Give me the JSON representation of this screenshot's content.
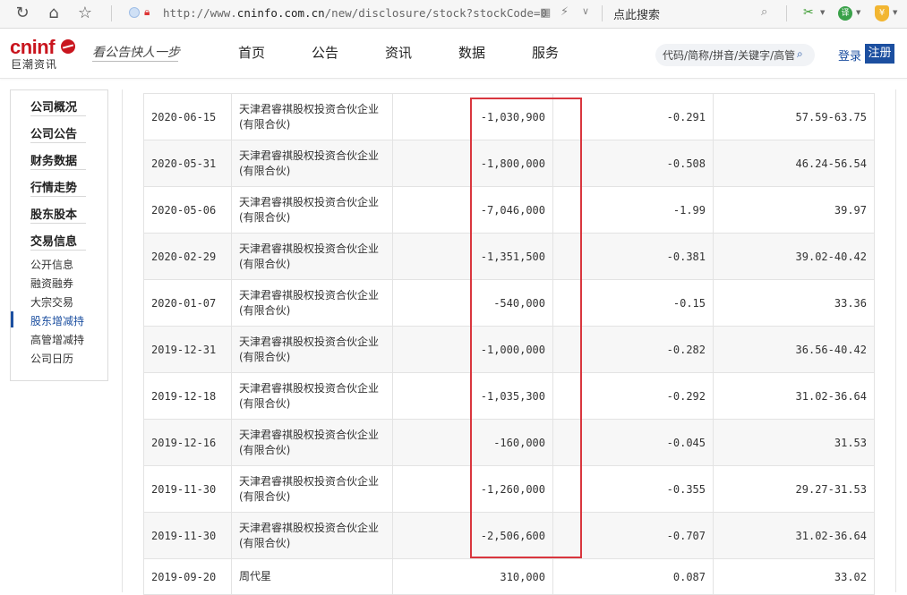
{
  "browser": {
    "url_prefix": "http://www.",
    "url_host": "cninfo.com.cn",
    "url_path": "/new/disclosure/stock?stockCode=0",
    "search_label": "点此搜索"
  },
  "site": {
    "logo_text": "cninf",
    "logo_cn": "巨潮资讯",
    "slogan": "看公告快人一步",
    "nav": [
      "首页",
      "公告",
      "资讯",
      "数据",
      "服务"
    ],
    "search_placeholder": "代码/简称/拼音/关键字/高管",
    "login": "登录",
    "register": "注册",
    "brand_color": "#c9151e",
    "accent_color": "#1c4fa0"
  },
  "sidebar": {
    "main_items": [
      "公司概况",
      "公司公告",
      "财务数据",
      "行情走势",
      "股东股本",
      "交易信息"
    ],
    "sub_items": [
      "公开信息",
      "融资融券",
      "大宗交易",
      "股东增减持",
      "高管增减持",
      "公司日历"
    ],
    "active_sub": "股东增减持"
  },
  "table": {
    "rows": [
      {
        "date": "2020-06-15",
        "holder_l1": "天津君睿祺股权投资合伙企业",
        "holder_l2": "(有限合伙)",
        "change": "-1,030,900",
        "ratio": "-0.291",
        "price": "57.59-63.75"
      },
      {
        "date": "2020-05-31",
        "holder_l1": "天津君睿祺股权投资合伙企业",
        "holder_l2": "(有限合伙)",
        "change": "-1,800,000",
        "ratio": "-0.508",
        "price": "46.24-56.54"
      },
      {
        "date": "2020-05-06",
        "holder_l1": "天津君睿祺股权投资合伙企业",
        "holder_l2": "(有限合伙)",
        "change": "-7,046,000",
        "ratio": "-1.99",
        "price": "39.97"
      },
      {
        "date": "2020-02-29",
        "holder_l1": "天津君睿祺股权投资合伙企业",
        "holder_l2": "(有限合伙)",
        "change": "-1,351,500",
        "ratio": "-0.381",
        "price": "39.02-40.42"
      },
      {
        "date": "2020-01-07",
        "holder_l1": "天津君睿祺股权投资合伙企业",
        "holder_l2": "(有限合伙)",
        "change": "-540,000",
        "ratio": "-0.15",
        "price": "33.36"
      },
      {
        "date": "2019-12-31",
        "holder_l1": "天津君睿祺股权投资合伙企业",
        "holder_l2": "(有限合伙)",
        "change": "-1,000,000",
        "ratio": "-0.282",
        "price": "36.56-40.42"
      },
      {
        "date": "2019-12-18",
        "holder_l1": "天津君睿祺股权投资合伙企业",
        "holder_l2": "(有限合伙)",
        "change": "-1,035,300",
        "ratio": "-0.292",
        "price": "31.02-36.64"
      },
      {
        "date": "2019-12-16",
        "holder_l1": "天津君睿祺股权投资合伙企业",
        "holder_l2": "(有限合伙)",
        "change": "-160,000",
        "ratio": "-0.045",
        "price": "31.53"
      },
      {
        "date": "2019-11-30",
        "holder_l1": "天津君睿祺股权投资合伙企业",
        "holder_l2": "(有限合伙)",
        "change": "-1,260,000",
        "ratio": "-0.355",
        "price": "29.27-31.53"
      },
      {
        "date": "2019-11-30",
        "holder_l1": "天津君睿祺股权投资合伙企业",
        "holder_l2": "(有限合伙)",
        "change": "-2,506,600",
        "ratio": "-0.707",
        "price": "31.02-36.64"
      },
      {
        "date": "2019-09-20",
        "holder_l1": "周代星",
        "holder_l2": "",
        "change": "310,000",
        "ratio": "0.087",
        "price": "33.02"
      }
    ],
    "highlight_color": "#d9363e"
  }
}
